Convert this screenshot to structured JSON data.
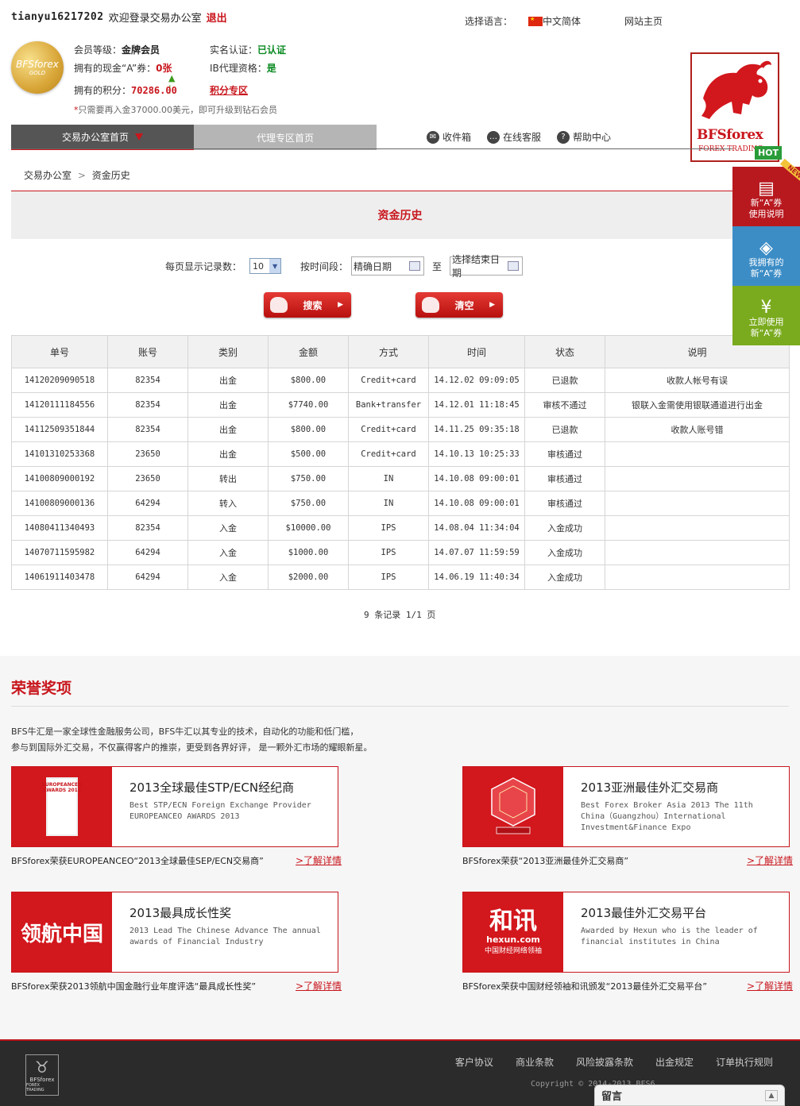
{
  "header": {
    "username": "tianyu16217202",
    "welcome": "欢迎登录交易办公室",
    "logout": "退出",
    "lang_label": "选择语言：",
    "lang_value": "中文简体",
    "site_home": "网站主页"
  },
  "member": {
    "badge_brand": "BFSforex",
    "badge_level": "GOLD",
    "level_label": "会员等级：",
    "level_value": "金牌会员",
    "verify_label": "实名认证：",
    "verify_value": "已认证",
    "coupon_label": "拥有的现金“A”券：",
    "coupon_value": "0张",
    "ib_label": "IB代理资格：",
    "ib_value": "是",
    "points_label": "拥有的积分：",
    "points_value": "70286.00",
    "points_link": "积分专区",
    "tip_star": "*",
    "tip": "只需要再入金37000.00美元，即可升级到钻石会员"
  },
  "logo": {
    "brand": "BFSforex",
    "sub": "FOREX TRADING"
  },
  "hot": "HOT",
  "nav": {
    "tab1": "交易办公室首页",
    "tab2": "代理专区首页"
  },
  "tools": {
    "inbox": "收件箱",
    "chat": "在线客服",
    "help": "帮助中心"
  },
  "breadcrumb": {
    "home": "交易办公室",
    "sep": ">",
    "current": "资金历史"
  },
  "panel_title": "资金历史",
  "filter": {
    "per_page_label": "每页显示记录数：",
    "per_page_value": "10",
    "time_label": "按时间段：",
    "start_placeholder": "精确日期",
    "to": "至",
    "end_placeholder": "选择结束日期",
    "search": "搜索",
    "clear": "清空"
  },
  "table": {
    "headers": [
      "单号",
      "账号",
      "类别",
      "金额",
      "方式",
      "时间",
      "状态",
      "说明"
    ],
    "rows": [
      [
        "14120209090518",
        "82354",
        "出金",
        "$800.00",
        "Credit+card",
        "14.12.02 09:09:05",
        "已退款",
        "收款人帐号有误"
      ],
      [
        "14120111184556",
        "82354",
        "出金",
        "$7740.00",
        "Bank+transfer",
        "14.12.01 11:18:45",
        "审核不通过",
        "银联入金需使用银联通道进行出金"
      ],
      [
        "14112509351844",
        "82354",
        "出金",
        "$800.00",
        "Credit+card",
        "14.11.25 09:35:18",
        "已退款",
        "收款人账号错"
      ],
      [
        "14101310253368",
        "23650",
        "出金",
        "$500.00",
        "Credit+card",
        "14.10.13 10:25:33",
        "审核通过",
        ""
      ],
      [
        "14100809000192",
        "23650",
        "转出",
        "$750.00",
        "IN",
        "14.10.08 09:00:01",
        "审核通过",
        ""
      ],
      [
        "14100809000136",
        "64294",
        "转入",
        "$750.00",
        "IN",
        "14.10.08 09:00:01",
        "审核通过",
        ""
      ],
      [
        "14080411340493",
        "82354",
        "入金",
        "$10000.00",
        "IPS",
        "14.08.04 11:34:04",
        "入金成功",
        ""
      ],
      [
        "14070711595982",
        "64294",
        "入金",
        "$1000.00",
        "IPS",
        "14.07.07 11:59:59",
        "入金成功",
        ""
      ],
      [
        "14061911403478",
        "64294",
        "入金",
        "$2000.00",
        "IPS",
        "14.06.19 11:40:34",
        "入金成功",
        ""
      ]
    ]
  },
  "pager": "9 条记录 1/1 页",
  "honor": {
    "title": "荣誉奖项",
    "desc1": "BFS牛汇是一家全球性金融服务公司，BFS牛汇以其专业的技术，自动化的功能和低门槛，",
    "desc2": "参与到国际外汇交易，不仅赢得客户的推崇，更受到各界好评， 是一颗外汇市场的耀眼新星。",
    "more": ">了解详情",
    "cards": [
      {
        "title": "2013全球最佳STP/ECN经纪商",
        "desc": "Best STP/ECN Foreign Exchange Provider EUROPEANCEO AWARDS 2013",
        "caption": "BFSforex荣获EUROPEANCEO“2013全球最佳SEP/ECN交易商”",
        "img": "EUROPEANCEO AWARDS 2013"
      },
      {
        "title": "2013亚洲最佳外汇交易商",
        "desc": "Best Forex Broker Asia 2013 The 11th China（Guangzhou）International Investment&Finance Expo",
        "caption": "BFSforex荣获“2013亚洲最佳外汇交易商”",
        "img": ""
      },
      {
        "title": "2013最具成长性奖",
        "desc": "2013 Lead The Chinese Advance The annual awards of Financial Industry",
        "caption": "BFSforex荣获2013领航中国金融行业年度评选“最具成长性奖”",
        "img": "领航中国"
      },
      {
        "title": "2013最佳外汇交易平台",
        "desc": "Awarded by Hexun who is the leader of financial institutes in China",
        "caption": "BFSforex荣获中国财经领袖和讯颁发“2013最佳外汇交易平台”",
        "img": "和讯",
        "img_sub": "hexun.com",
        "img_sub2": "中国财经网络领袖"
      }
    ]
  },
  "side": [
    {
      "line1": "新“A”券",
      "line2": "使用说明",
      "color": "#b8191f",
      "tag": "NEW"
    },
    {
      "line1": "我拥有的",
      "line2": "新“A”券",
      "color": "#3c8dc6"
    },
    {
      "line1": "立即使用",
      "line2": "新“A”券",
      "color": "#7aab1e"
    }
  ],
  "footer": {
    "links": [
      "客户协议",
      "商业条款",
      "风险披露条款",
      "出金规定",
      "订单执行规则"
    ],
    "copyright": "Copyright © 2014-2013 BFS6...",
    "logo": "BFSforex",
    "logo_sub": "FOREX TRADING"
  },
  "message": "留言"
}
